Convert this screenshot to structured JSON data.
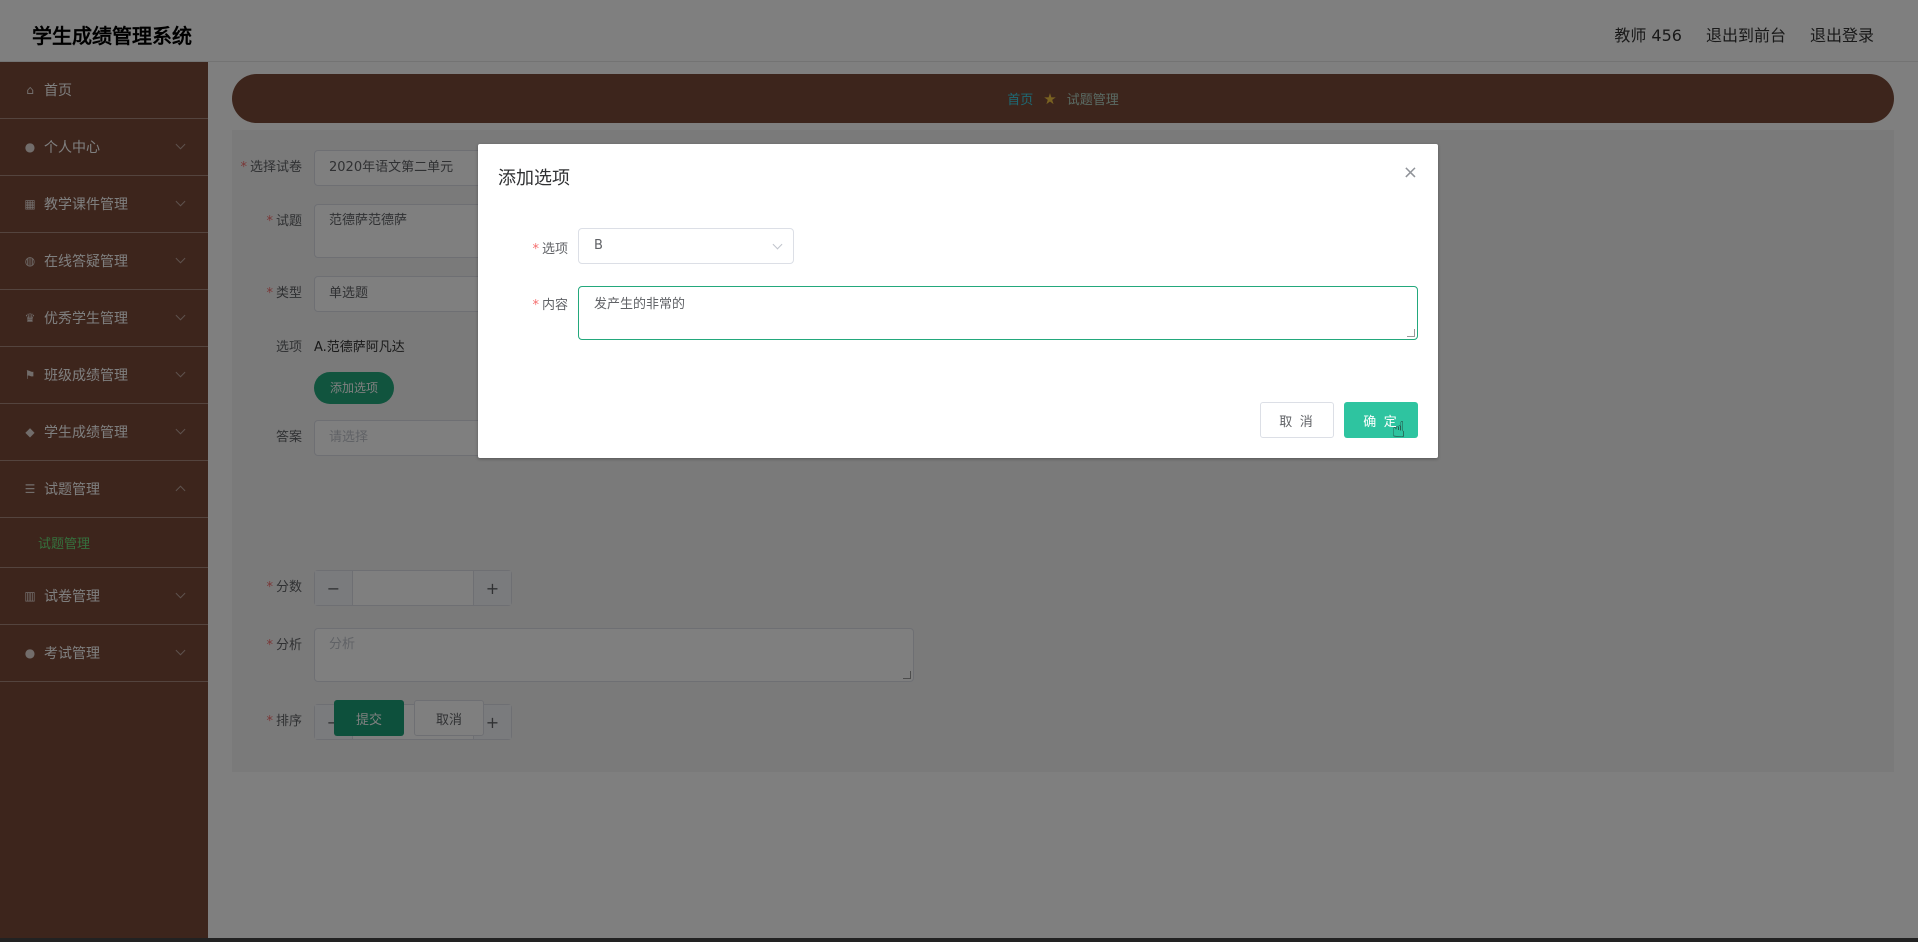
{
  "header": {
    "title": "学生成绩管理系统",
    "user": "教师 456",
    "to_front": "退出到前台",
    "logout": "退出登录"
  },
  "sidebar": {
    "items": [
      {
        "label": "首页",
        "icon": "home-icon"
      },
      {
        "label": "个人中心",
        "icon": "user-icon"
      },
      {
        "label": "教学课件管理",
        "icon": "grid-icon"
      },
      {
        "label": "在线答疑管理",
        "icon": "help-icon"
      },
      {
        "label": "优秀学生管理",
        "icon": "trophy-icon"
      },
      {
        "label": "班级成绩管理",
        "icon": "flag-icon"
      },
      {
        "label": "学生成绩管理",
        "icon": "cap-icon"
      },
      {
        "label": "试题管理",
        "icon": "list-icon"
      },
      {
        "label": "试卷管理",
        "icon": "chart-icon"
      },
      {
        "label": "考试管理",
        "icon": "person-icon"
      }
    ],
    "submenu_label": "试题管理"
  },
  "breadcrumb": {
    "home": "首页",
    "current": "试题管理"
  },
  "form": {
    "paper_label": "选择试卷",
    "paper_value": "2020年语文第二单元",
    "question_label": "试题",
    "question_value": "范德萨范德萨",
    "type_label": "类型",
    "type_value": "单选题",
    "options_label": "选项",
    "options_value": "A.范德萨阿凡达",
    "add_option": "添加选项",
    "answer_label": "答案",
    "answer_placeholder": "请选择",
    "score_label": "分数",
    "analysis_label": "分析",
    "analysis_placeholder": "分析",
    "order_label": "排序",
    "submit": "提交",
    "cancel": "取消",
    "minus": "−",
    "plus": "+"
  },
  "dialog": {
    "title": "添加选项",
    "close": "×",
    "option_label": "选项",
    "option_value": "B",
    "content_label": "内容",
    "content_value": "发产生的非常的",
    "cancel": "取 消",
    "ok": "确 定"
  },
  "colors": {
    "sidebar": "#7a4a38",
    "accent": "#23a87c",
    "confirm": "#2ec4a0"
  }
}
